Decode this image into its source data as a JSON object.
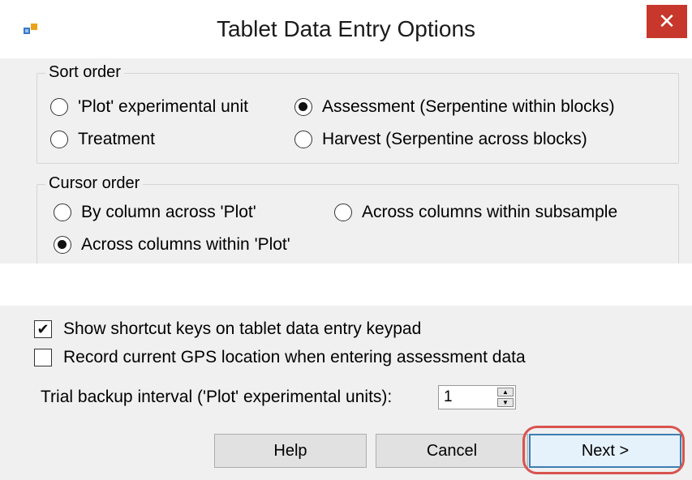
{
  "window": {
    "title": "Tablet Data Entry Options",
    "close_glyph": "✕",
    "app_icon": "app-window-icon"
  },
  "sort_order": {
    "title": "Sort order",
    "options": [
      {
        "label": "'Plot' experimental unit",
        "checked": false
      },
      {
        "label": "Assessment (Serpentine within blocks)",
        "checked": true
      },
      {
        "label": "Treatment",
        "checked": false
      },
      {
        "label": "Harvest (Serpentine across blocks)",
        "checked": false
      }
    ]
  },
  "cursor_order": {
    "title": "Cursor order",
    "options": [
      {
        "label": "By column across 'Plot'",
        "checked": false
      },
      {
        "label": "Across columns within subsample",
        "checked": false
      },
      {
        "label": "Across columns within 'Plot'",
        "checked": true
      }
    ]
  },
  "checkboxes": [
    {
      "label": "Show shortcut keys on tablet data entry keypad",
      "checked": true
    },
    {
      "label": "Record current GPS location when entering assessment data",
      "checked": false
    }
  ],
  "backup": {
    "label": "Trial backup interval ('Plot' experimental units):",
    "value": "1"
  },
  "buttons": {
    "help": "Help",
    "cancel": "Cancel",
    "next": "Next >"
  },
  "colors": {
    "close_bg": "#c7372b",
    "highlight_ring": "#d9534f"
  }
}
